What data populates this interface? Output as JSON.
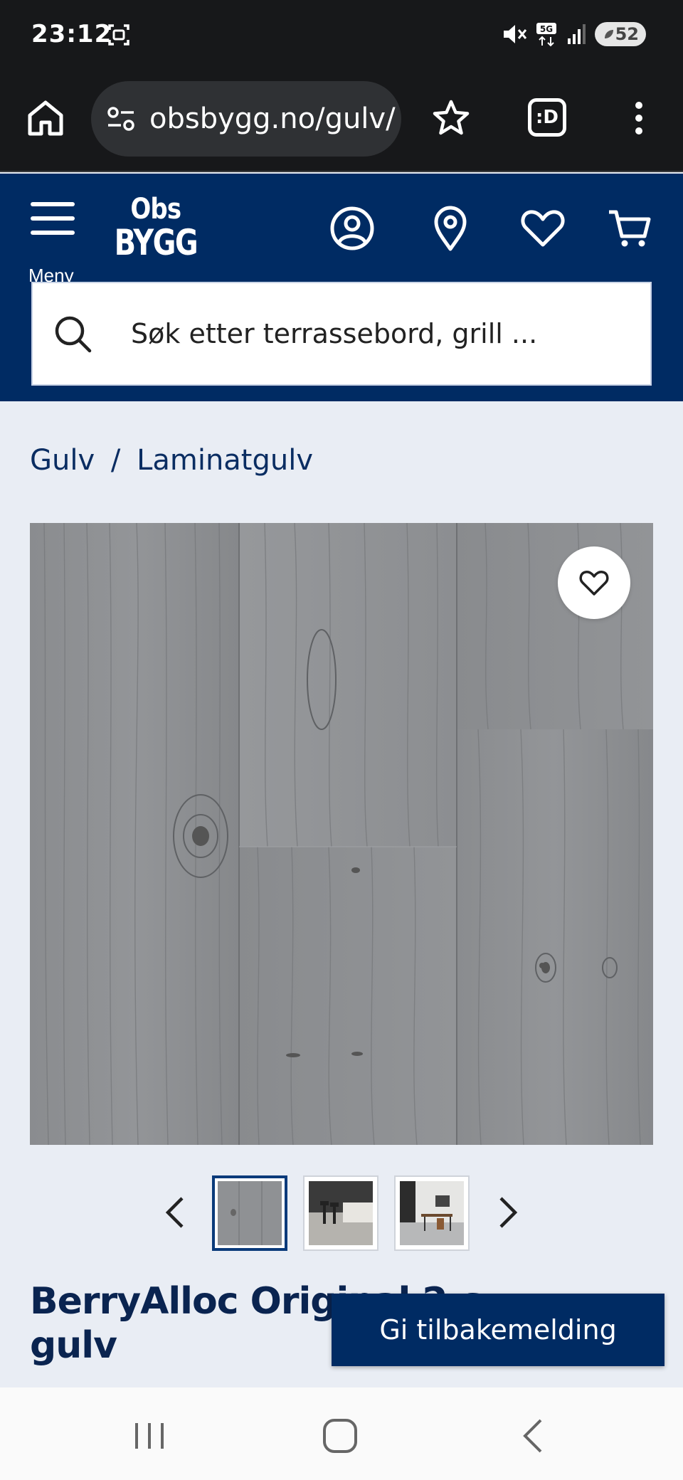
{
  "status_bar": {
    "time": "23:12",
    "network": "5G",
    "battery": "52"
  },
  "browser": {
    "url": "obsbygg.no/gulv/",
    "extension_label": ":D"
  },
  "header": {
    "menu_label": "Meny",
    "logo_line1": "Obs",
    "logo_line2": "BYGG",
    "search_placeholder": "Søk etter terrassebord, grill ..."
  },
  "breadcrumb": {
    "items": [
      "Gulv",
      "Laminatgulv"
    ],
    "separator": "/"
  },
  "product": {
    "title": "BerryAlloc Original 2-s",
    "title_line2": "gulv",
    "thumbnails": [
      "grey-wood-plank",
      "kitchen-interior",
      "office-interior"
    ],
    "active_thumbnail": 0
  },
  "feedback_button": "Gi tilbakemelding",
  "colors": {
    "brand_navy": "#002b63",
    "page_bg": "#e9edf4",
    "status_bg": "#17181a"
  }
}
